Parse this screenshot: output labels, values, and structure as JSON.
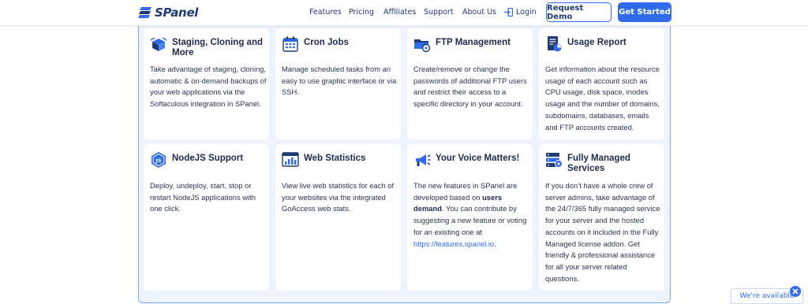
{
  "header": {
    "logo_text": "SPanel",
    "nav": [
      "Features",
      "Pricing",
      "Affiliates",
      "Support",
      "About Us"
    ],
    "login_label": "Login",
    "request_demo_label": "Request Demo",
    "get_started_label": "Get Started"
  },
  "cards": [
    {
      "title_line1": "Staging, Cloning and",
      "title_line2": "More",
      "icon": "box-icon",
      "desc": "Take advantage of staging, cloning, automatic & on-demand backups of your web applications via the Softaculous integration in SPanel."
    },
    {
      "title": "Cron Jobs",
      "icon": "calendar-icon",
      "desc": "Manage scheduled tasks from an easy to use graphic interface or via SSH."
    },
    {
      "title": "FTP Management",
      "icon": "folder-gear-icon",
      "desc": "Create/remove or change the passwords of additional FTP users and restrict their access to a specific directory in your account."
    },
    {
      "title": "Usage Report",
      "icon": "report-icon",
      "desc": "Get information about the resource usage of each account such as CPU usage, disk space, inodes usage and the number of domains, subdomains, databases, emails and FTP accounts created."
    },
    {
      "title": "NodeJS Support",
      "icon": "nodejs-icon",
      "desc": "Deploy, undeploy, start, stop or restart NodeJS applications with one click."
    },
    {
      "title": "Web Statistics",
      "icon": "web-stats-icon",
      "desc": "View live web statistics for each of your websites via the integrated GoAccess web stats."
    },
    {
      "title": "Your Voice Matters!",
      "icon": "megaphone-icon",
      "desc_a": "The new features in SPanel are developed based on ",
      "desc_bold": "users demand",
      "desc_b": ". You can contribute by suggesting a new feature or voting for an existing one at ",
      "desc_link": "https://features.spanel.io",
      "desc_c": "."
    },
    {
      "title": "Fully Managed Services",
      "icon": "server-icon",
      "desc": "If you don’t have a whole crew of server admins, take advantage of the 24/7/365 fully managed service for your server and the hosted accounts on it included in the Fully Managed license addon. Get friendly & professional assistance for all your server related questions."
    }
  ],
  "chat": {
    "label": "We're available"
  },
  "colors": {
    "accent": "#2f6bea",
    "navy": "#1f3b73",
    "section_bg": "#eef4ff"
  }
}
